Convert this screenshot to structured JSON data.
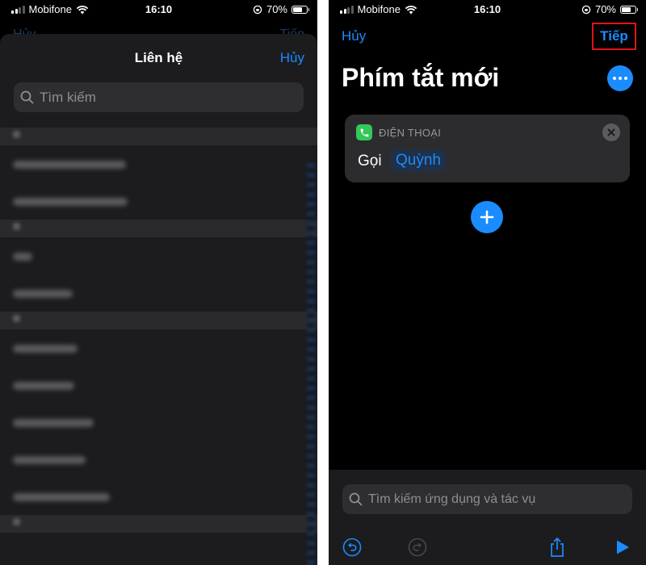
{
  "status_bar": {
    "carrier": "Mobifone",
    "time": "16:10",
    "battery": "70%"
  },
  "left_screen": {
    "behind_cancel": "Hủy",
    "behind_next": "Tiếp",
    "sheet": {
      "title": "Liên hệ",
      "cancel_label": "Hủy",
      "search_placeholder": "Tìm kiếm"
    }
  },
  "right_screen": {
    "cancel_label": "Hủy",
    "next_label": "Tiếp",
    "title": "Phím tắt mới",
    "action_card": {
      "app_name": "ĐIỆN THOẠI",
      "verb": "Gọi",
      "contact": "Quỳnh"
    },
    "search_placeholder": "Tìm kiếm ứng dụng và tác vụ"
  },
  "colors": {
    "accent": "#1a8cff",
    "highlight_box": "#e01414",
    "phone_app_green": "#34c759"
  }
}
